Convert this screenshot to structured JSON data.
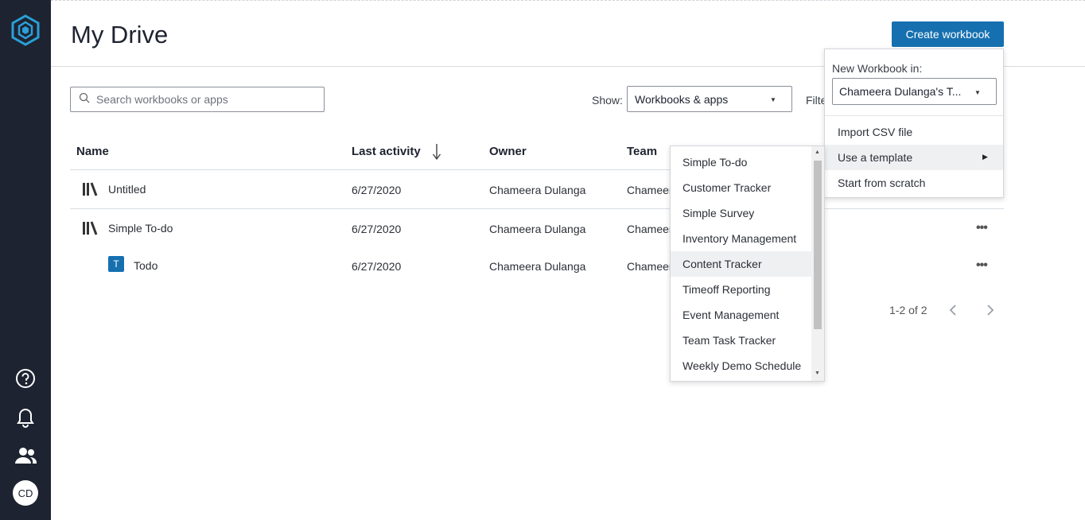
{
  "sidebar": {
    "avatar_initials": "CD",
    "icons": [
      "logo-icon",
      "help-icon",
      "bell-icon",
      "users-icon"
    ]
  },
  "page": {
    "title": "My Drive"
  },
  "header": {
    "create_label": "Create workbook"
  },
  "toolbar": {
    "search_placeholder": "Search workbooks or apps",
    "show_label": "Show:",
    "show_value": "Workbooks & apps",
    "filter_label": "Filter"
  },
  "table": {
    "columns": {
      "name": "Name",
      "last_activity": "Last activity",
      "owner": "Owner",
      "team": "Team"
    },
    "rows": [
      {
        "name": "Untitled",
        "type": "workbook",
        "last_activity": "6/27/2020",
        "owner": "Chameera Dulanga",
        "team": "Chameera Dulanga's Team"
      },
      {
        "name": "Simple To-do",
        "type": "workbook",
        "last_activity": "6/27/2020",
        "owner": "Chameera Dulanga",
        "team": "Chameera Dulanga's Team"
      },
      {
        "name": "Todo",
        "type": "app",
        "app_letter": "T",
        "last_activity": "6/27/2020",
        "owner": "Chameera Dulanga",
        "team": "Chameera Dulanga's Team"
      }
    ],
    "pager": "1-2 of 2"
  },
  "new_workbook_menu": {
    "label": "New Workbook in:",
    "team_value": "Chameera Dulanga's T...",
    "items": [
      "Import CSV file",
      "Use a template",
      "Start from scratch"
    ]
  },
  "template_menu": {
    "items": [
      "Simple To-do",
      "Customer Tracker",
      "Simple Survey",
      "Inventory Management",
      "Content Tracker",
      "Timeoff Reporting",
      "Event Management",
      "Team Task Tracker",
      "Weekly Demo Schedule"
    ],
    "hovered": "Content Tracker"
  },
  "colors": {
    "sidebar": "#1d2331",
    "accent": "#1670b0"
  }
}
